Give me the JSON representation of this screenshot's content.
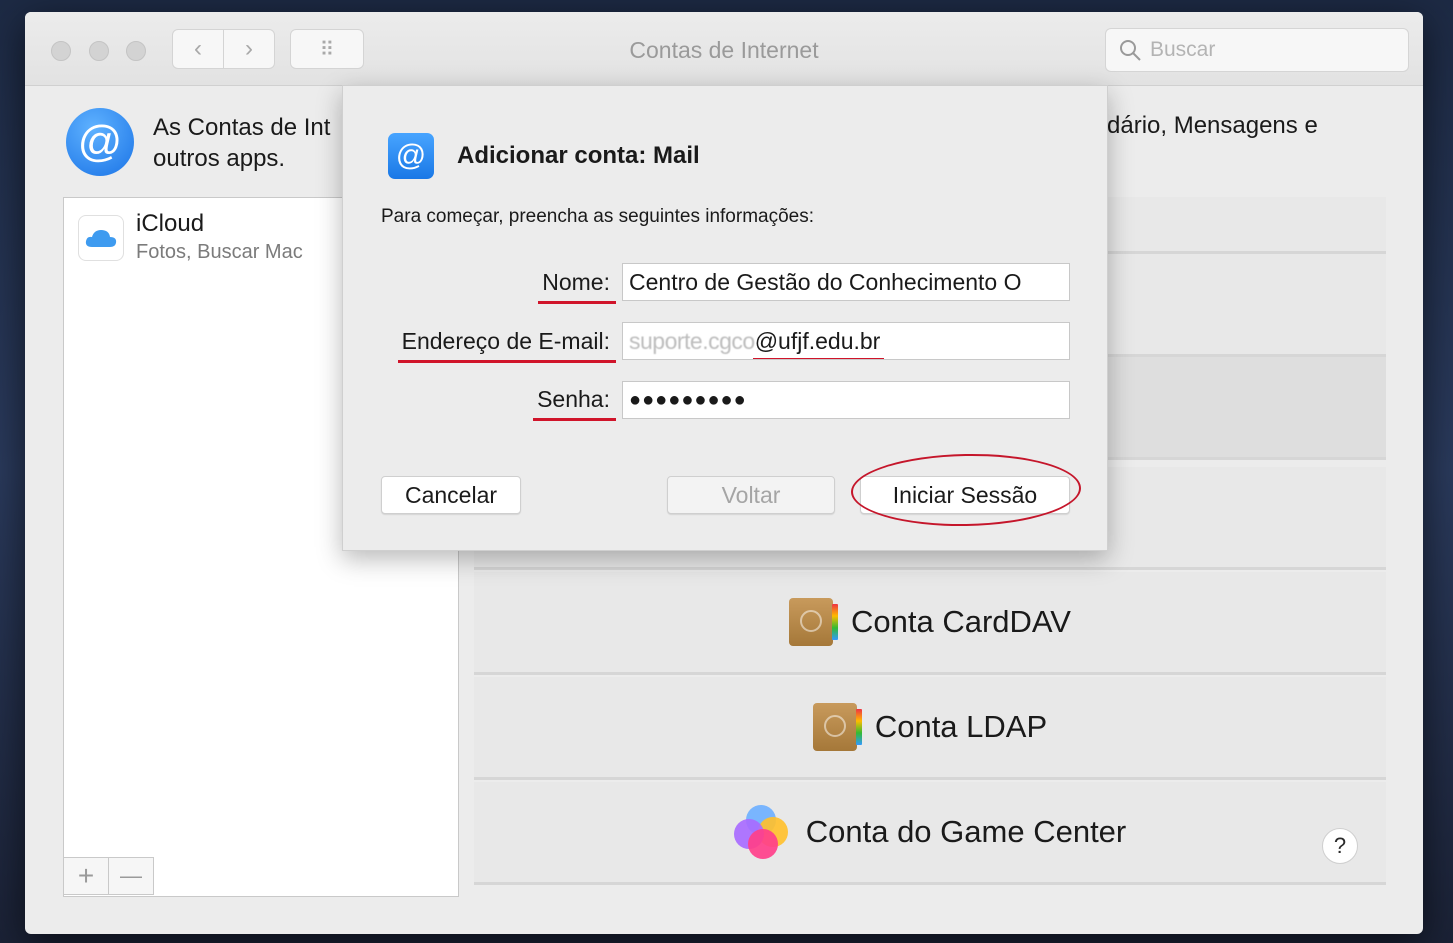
{
  "window": {
    "title": "Contas de Internet"
  },
  "toolbar": {
    "back_glyph": "‹",
    "forward_glyph": "›",
    "grid_glyph": "⠿"
  },
  "search": {
    "placeholder": "Buscar"
  },
  "header": {
    "text_left": "As Contas de Int",
    "text_left_line2": "outros apps.",
    "text_right": "dário, Mensagens e"
  },
  "sidebar": {
    "items": [
      {
        "name": "iCloud",
        "subtitle": "Fotos, Buscar Mac"
      }
    ],
    "add_label": "+",
    "remove_label": "—"
  },
  "providers": [
    {
      "label": ""
    },
    {
      "label": ""
    },
    {
      "label": ""
    },
    {
      "label": ""
    },
    {
      "label": "Conta CardDAV",
      "icon": "contacts-icon"
    },
    {
      "label": "Conta LDAP",
      "icon": "contacts-icon"
    },
    {
      "label": "Conta do Game Center",
      "icon": "game-center-icon"
    }
  ],
  "help_label": "?",
  "sheet": {
    "title": "Adicionar conta: Mail",
    "intro": "Para começar, preencha as seguintes informações:",
    "name_label": "Nome:",
    "name_value": "Centro de Gestão do Conhecimento O",
    "email_label": "Endereço de E-mail:",
    "email_local": "suporte.cgco",
    "email_domain": "@ufjf.edu.br",
    "password_label": "Senha:",
    "password_value": "●●●●●●●●●",
    "cancel": "Cancelar",
    "back": "Voltar",
    "sign_in": "Iniciar Sessão"
  },
  "colors": {
    "annotation": "#d0142a",
    "accent": "#1a78e6"
  }
}
